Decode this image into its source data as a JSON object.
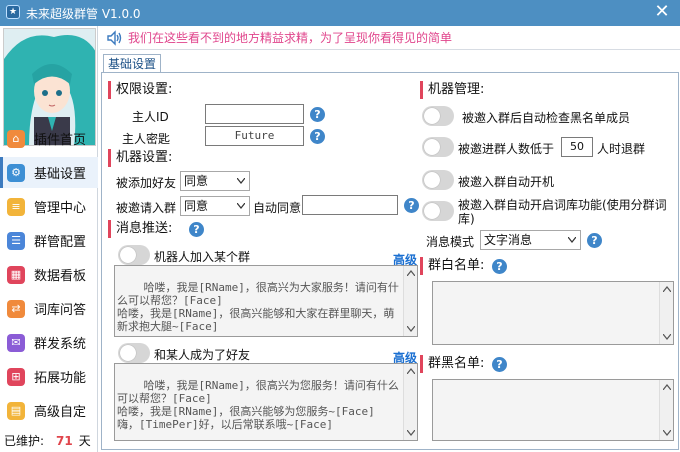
{
  "window": {
    "title": "未来超级群管 V1.0.0",
    "close_glyph": "✕"
  },
  "marquee": {
    "text": "我们在这些看不到的地方精益求精，为了呈现你看得见的简单"
  },
  "sidebar": {
    "items": [
      {
        "label": "插件首页",
        "icon": "home-icon",
        "color": "#f08a3c"
      },
      {
        "label": "基础设置",
        "icon": "settings-icon",
        "color": "#3d8fd4"
      },
      {
        "label": "管理中心",
        "icon": "manage-icon",
        "color": "#f2b43a"
      },
      {
        "label": "群管配置",
        "icon": "config-icon",
        "color": "#4b86d9"
      },
      {
        "label": "数据看板",
        "icon": "dashboard-icon",
        "color": "#e0455c"
      },
      {
        "label": "词库问答",
        "icon": "qa-icon",
        "color": "#f08a3c"
      },
      {
        "label": "群发系统",
        "icon": "broadcast-icon",
        "color": "#8b5cd6"
      },
      {
        "label": "拓展功能",
        "icon": "extend-icon",
        "color": "#e0455c"
      },
      {
        "label": "高级自定",
        "icon": "advanced-icon",
        "color": "#f2b43a"
      }
    ],
    "maintained": {
      "label": "已维护:",
      "days": "71",
      "unit": "天"
    }
  },
  "tab": {
    "label": "基础设置"
  },
  "permissions": {
    "header": "权限设置:",
    "owner_label": "主人ID",
    "owner_value": "",
    "key_label": "主人密匙",
    "key_value": "Future"
  },
  "robot": {
    "header": "机器设置:",
    "add_friend_label": "被添加好友",
    "add_friend_value": "同意",
    "invite_label": "被邀请入群",
    "invite_value": "同意",
    "auto_agree_label": "自动同意",
    "auto_agree_value": ""
  },
  "messages": {
    "header": "消息推送:",
    "join_group_toggle": "机器人加入某个群",
    "advanced_label": "高级",
    "join_group_text": "哈喽，我是[RName]，很高兴为大家服务！请问有什么可以帮您？[Face]\n哈喽，我是[RName]，很高兴能够和大家在群里聊天，萌新求抱大腿~[Face]",
    "friend_toggle": "和某人成为了好友",
    "friend_text": "哈喽，我是[RName]，很高兴为您服务！请问有什么可以帮您？[Face]\n哈喽，我是[RName]，很高兴能够为您服务~[Face]\n嗨，[TimePer]好，以后常联系哦~[Face]"
  },
  "machine": {
    "header": "机器管理:",
    "opt1": "被邀入群后自动检查黑名单成员",
    "opt2_prefix": "被邀进群人数低于",
    "opt2_value": "50",
    "opt2_suffix": "人时退群",
    "opt3": "被邀入群自动开机",
    "opt4": "被邀入群自动开启词库功能(使用分群词库)",
    "msg_mode_label": "消息模式",
    "msg_mode_value": "文字消息",
    "whitelist_label": "群白名单:",
    "blacklist_label": "群黑名单:"
  }
}
